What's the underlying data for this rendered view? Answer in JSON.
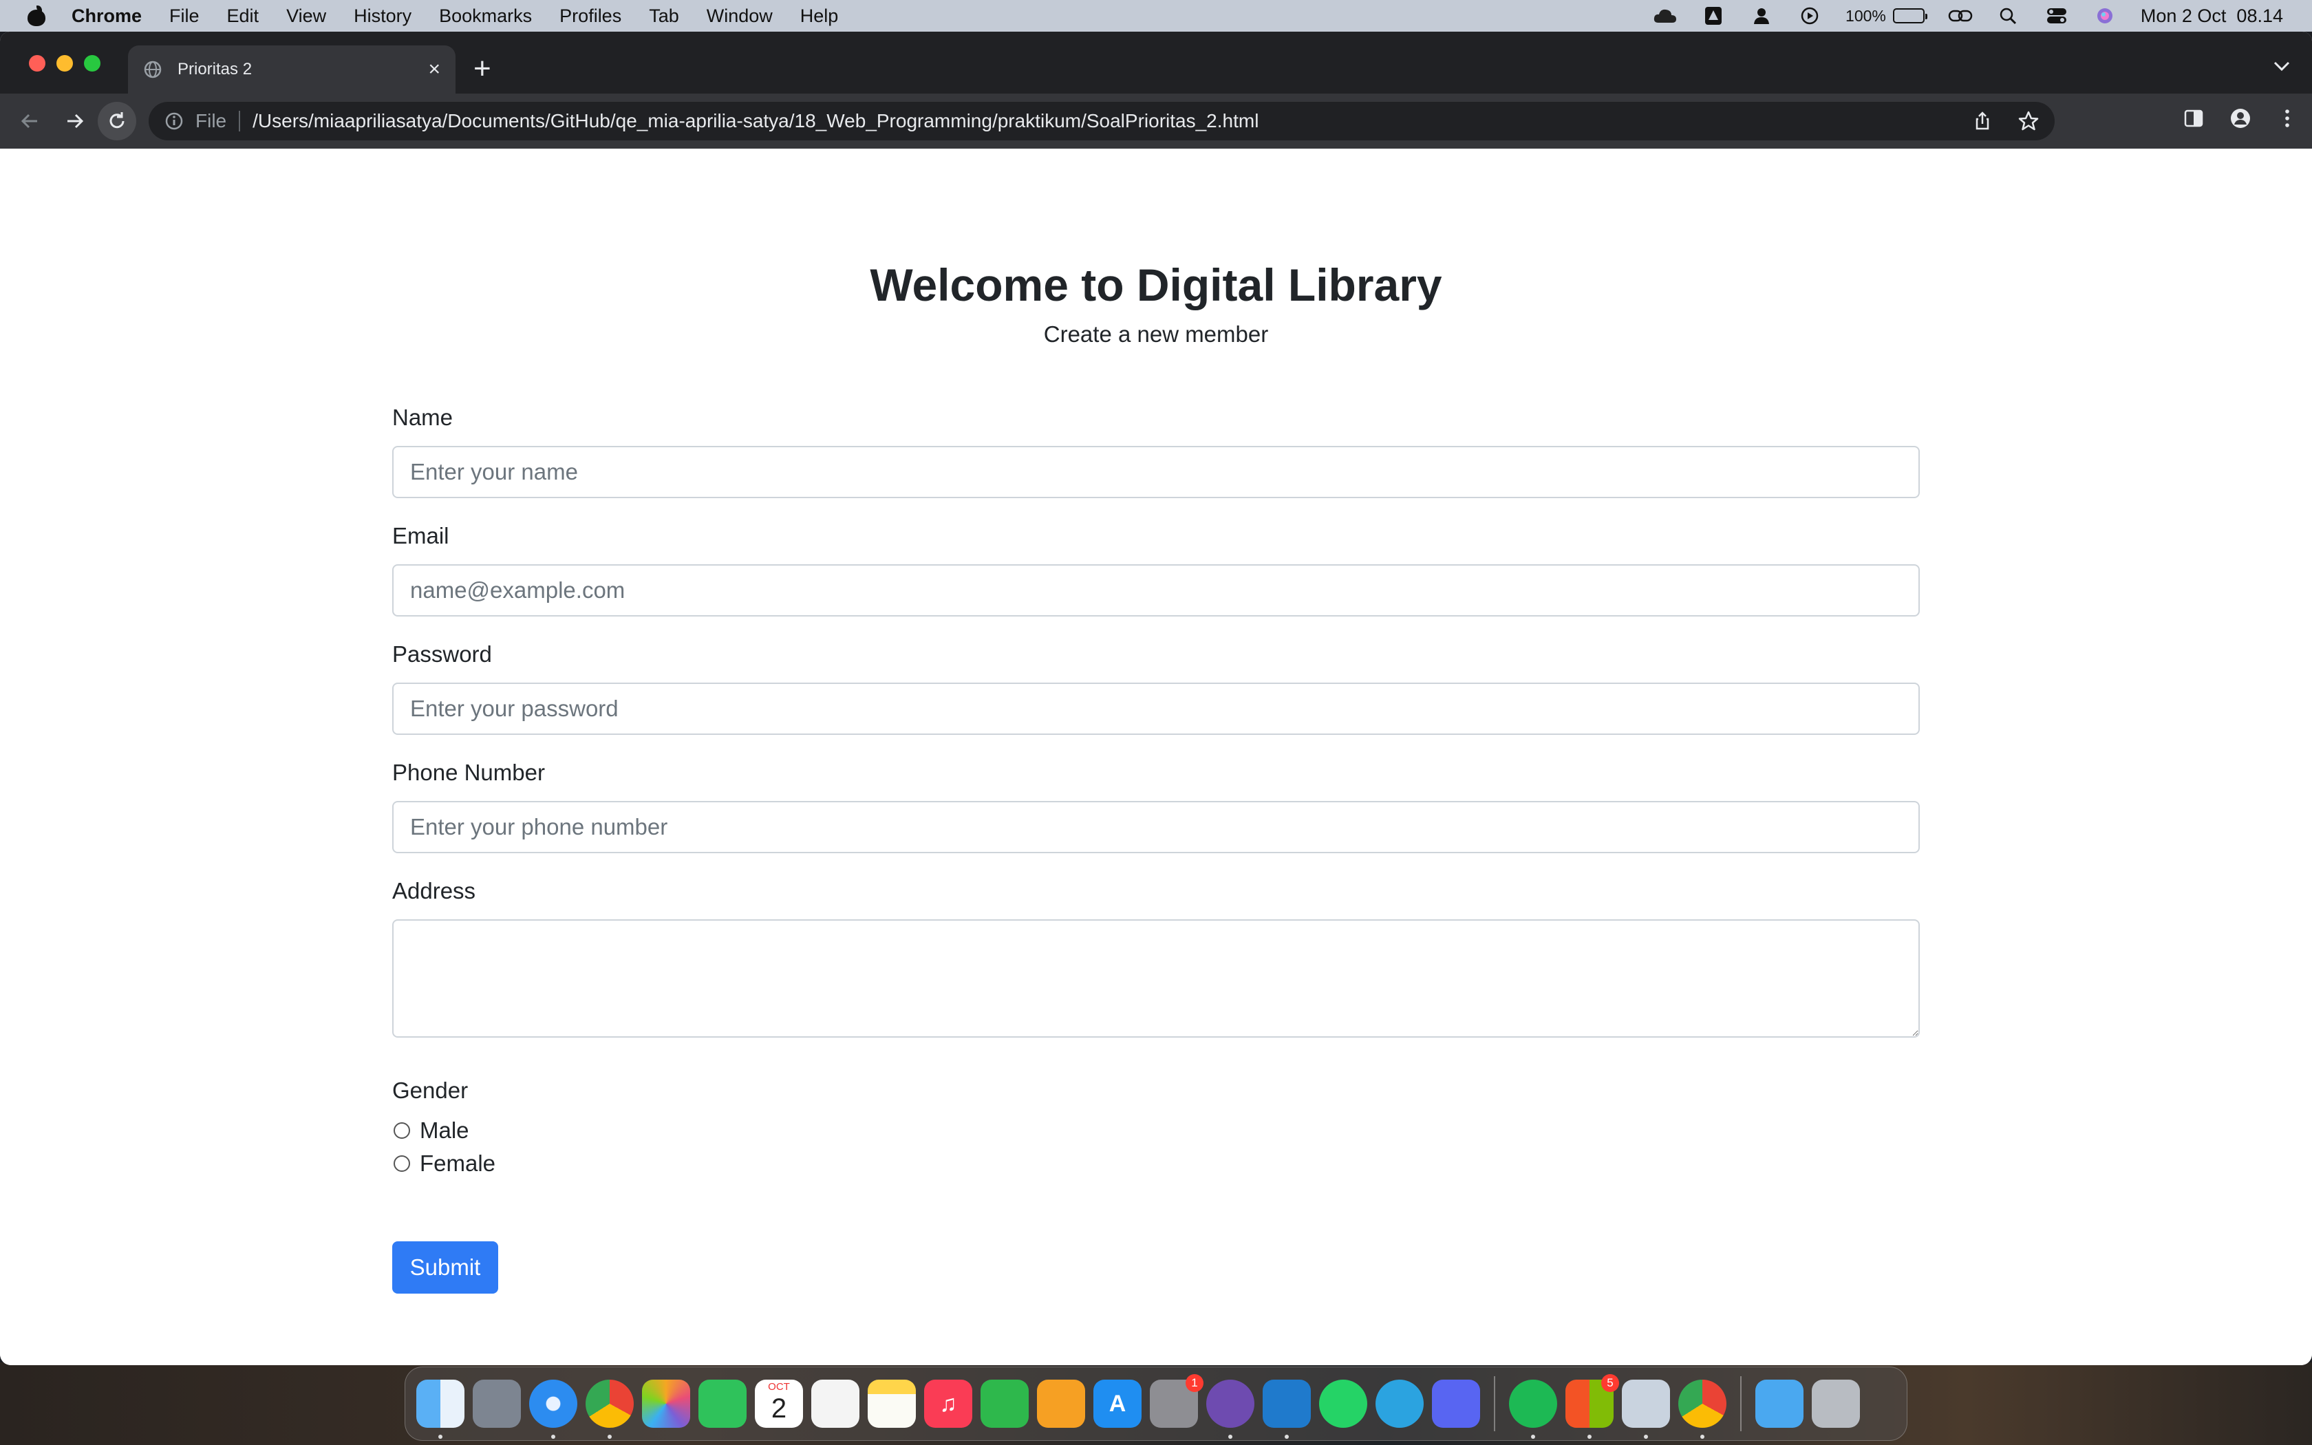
{
  "menubar": {
    "app_name": "Chrome",
    "items": [
      "File",
      "Edit",
      "View",
      "History",
      "Bookmarks",
      "Profiles",
      "Tab",
      "Window",
      "Help"
    ],
    "battery": "100%",
    "datetime": "Mon 2 Oct  08.14"
  },
  "browser": {
    "tab_title": "Prioritas 2",
    "scheme_label": "File",
    "url": "/Users/miaapriliasatya/Documents/GitHub/qe_mia-aprilia-satya/18_Web_Programming/praktikum/SoalPrioritas_2.html"
  },
  "page": {
    "title": "Welcome to Digital Library",
    "subtitle": "Create a new member",
    "fields": {
      "name": {
        "label": "Name",
        "placeholder": "Enter your name"
      },
      "email": {
        "label": "Email",
        "placeholder": "name@example.com"
      },
      "password": {
        "label": "Password",
        "placeholder": "Enter your password"
      },
      "phone": {
        "label": "Phone Number",
        "placeholder": "Enter your phone number"
      },
      "address": {
        "label": "Address",
        "placeholder": ""
      }
    },
    "gender": {
      "label": "Gender",
      "options": [
        "Male",
        "Female"
      ]
    },
    "submit_label": "Submit"
  },
  "dock": {
    "calendar_month": "OCT",
    "calendar_day": "2",
    "system_settings_badge": "1",
    "store_badge": "5"
  },
  "colors": {
    "accent": "#2f7bf5",
    "tabbar": "#202124",
    "toolbar": "#35363a",
    "menubar": "#c4cbd6"
  }
}
